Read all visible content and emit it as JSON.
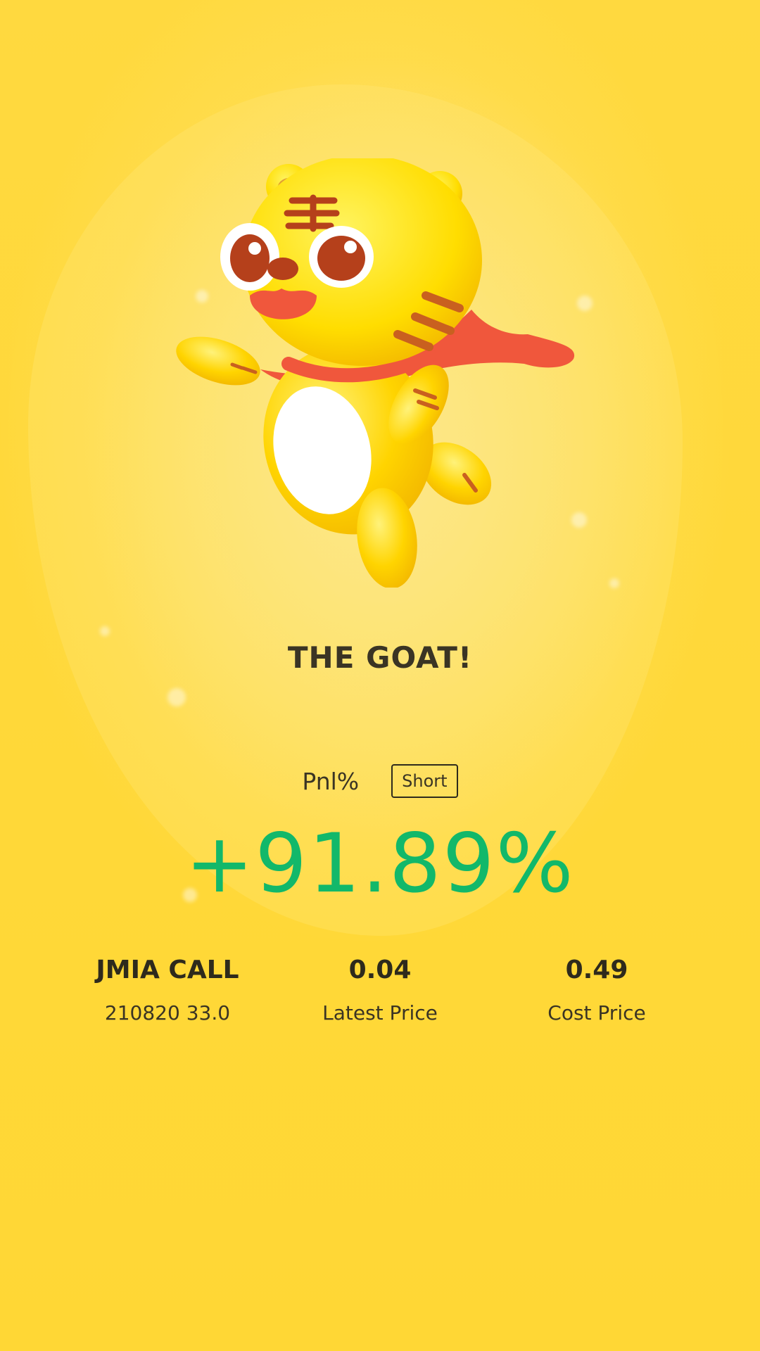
{
  "title": "THE GOAT!",
  "pnl": {
    "label": "Pnl%",
    "direction_badge": "Short",
    "value": "+91.89%",
    "value_color": "#12b86a"
  },
  "stats": [
    {
      "value": "JMIA CALL",
      "label": "210820 33.0"
    },
    {
      "value": "0.04",
      "label": "Latest Price"
    },
    {
      "value": "0.49",
      "label": "Cost Price"
    }
  ],
  "icons": {
    "mascot": "tiger-mascot-icon"
  },
  "colors": {
    "background": "#ffd93f",
    "text": "#2e2a1c",
    "accent_red": "#f0573c"
  }
}
